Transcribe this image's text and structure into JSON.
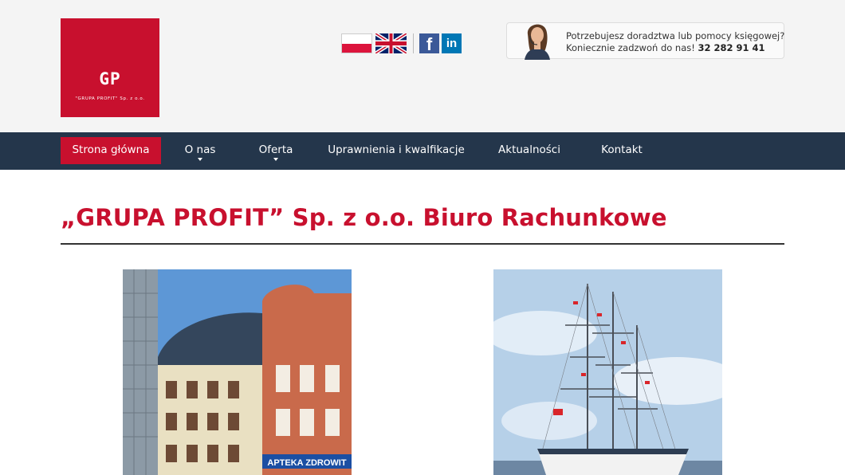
{
  "logo": {
    "mark": "GP",
    "subtitle": "\"GRUPA PROFIT\" Sp. z o.o."
  },
  "languages": [
    {
      "name": "polish-flag-icon"
    },
    {
      "name": "british-flag-icon"
    }
  ],
  "social": {
    "facebook": {
      "icon": "facebook-icon",
      "glyph": "f"
    },
    "linkedin": {
      "icon": "linkedin-icon",
      "glyph": "in"
    }
  },
  "help": {
    "line1": "Potrzebujesz doradztwa lub pomocy księgowej?",
    "line2_prefix": "Koniecznie zadzwoń do nas!",
    "phone": "32 282 91 41"
  },
  "nav": {
    "items": [
      {
        "label": "Strona główna"
      },
      {
        "label": "O nas"
      },
      {
        "label": "Oferta"
      },
      {
        "label": "Uprawnienia i kwalfikacje"
      },
      {
        "label": "Aktualności"
      },
      {
        "label": "Kontakt"
      }
    ]
  },
  "main": {
    "title": "„GRUPA PROFIT” Sp. z o.o. Biuro Rachunkowe"
  },
  "photos": {
    "building_sign": "APTEKA ZDROWIT"
  },
  "colors": {
    "brand_red": "#c8102e",
    "nav_bg": "#24364b",
    "header_bg": "#f4f4f4"
  }
}
